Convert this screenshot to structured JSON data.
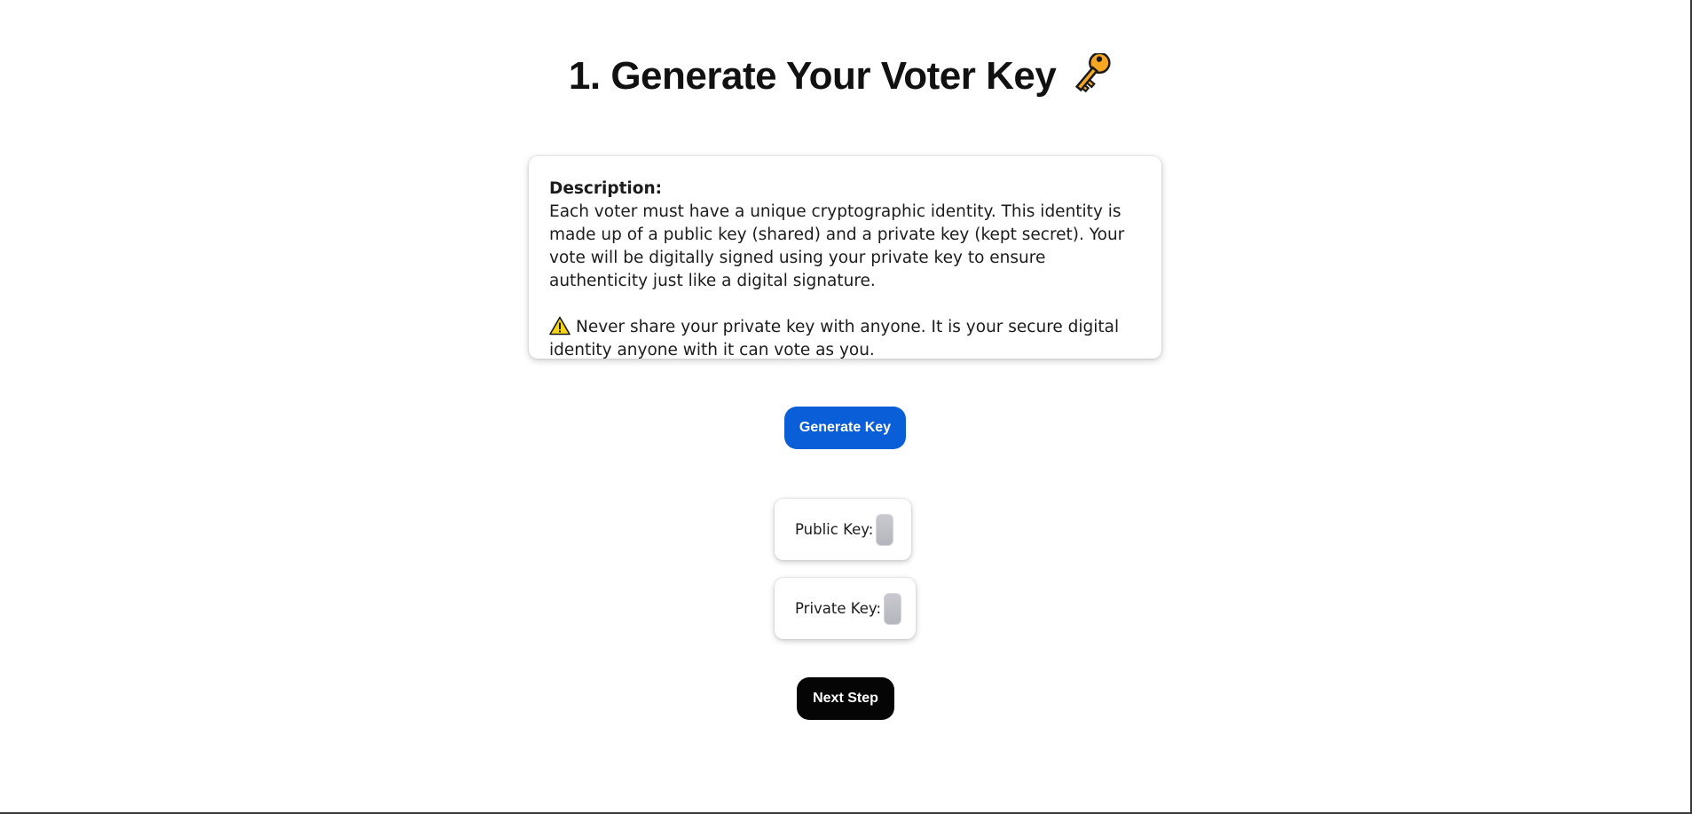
{
  "page": {
    "title": "1. Generate Your Voter Key",
    "title_icon": "key-icon"
  },
  "description": {
    "label": "Description:",
    "body": "Each voter must have a unique cryptographic identity. This identity is made up of a public key (shared) and a private key (kept secret). Your vote will be digitally signed using your private key to ensure authenticity just like a digital signature.",
    "warning_icon": "warning-icon",
    "warning": "Never share your private key with anyone. It is your secure digital identity anyone with it can vote as you."
  },
  "actions": {
    "generate_label": "Generate Key",
    "next_label": "Next Step"
  },
  "keys": {
    "public_label": "Public Key:",
    "public_value": "",
    "private_label": "Private Key:",
    "private_value": ""
  },
  "colors": {
    "primary_button": "#0a5fd8",
    "next_button": "#050505",
    "key_field": "#bdbdc4"
  }
}
